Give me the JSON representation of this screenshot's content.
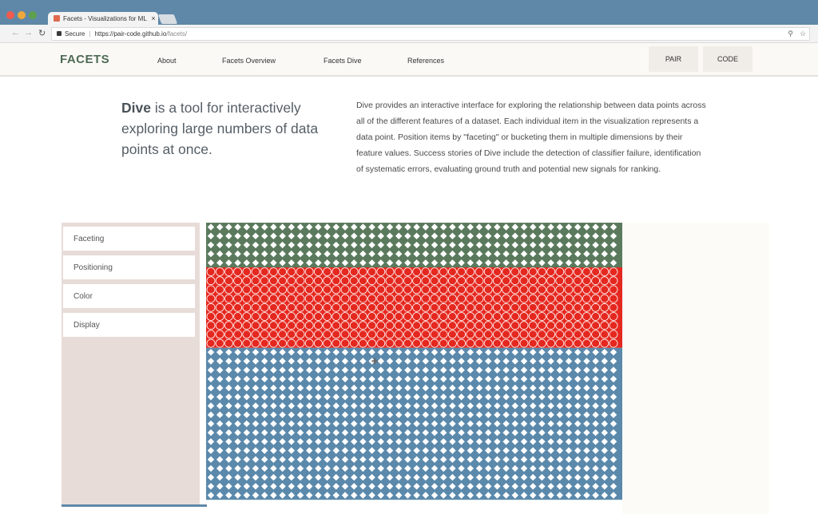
{
  "browser": {
    "tab_title": "Facets - Visualizations for ML",
    "tab_close": "×",
    "address": {
      "secure_label": "Secure",
      "separator": "|",
      "host": "https://pair-code.github.io",
      "path": "/facets/"
    },
    "window_controls": {
      "close_color": "#f25a50",
      "minimize_color": "#f0a83a",
      "maximize_color": "#5fa04e"
    }
  },
  "site": {
    "logo": "FACETS",
    "nav": [
      {
        "label": "About"
      },
      {
        "label": "Facets Overview"
      },
      {
        "label": "Facets Dive"
      },
      {
        "label": "References"
      }
    ],
    "buttons": [
      {
        "label": "PAIR"
      },
      {
        "label": "CODE"
      }
    ]
  },
  "intro": {
    "lead_bold": "Dive",
    "lead_rest": " is a tool for interactively exploring large numbers of data points at once.",
    "description": "Dive provides an interactive interface for exploring the relationship between data points across all of the different features of a dataset. Each individual item in the visualization represents a data point. Position items by \"faceting\" or bucketing them in multiple dimensions by their feature values. Success stories of Dive include the detection of classifier failure, identification of systematic errors, evaluating ground truth and potential new signals for ranking."
  },
  "dive": {
    "controls": [
      {
        "label": "Faceting"
      },
      {
        "label": "Positioning"
      },
      {
        "label": "Color"
      },
      {
        "label": "Display"
      }
    ],
    "bands": [
      {
        "color": "#5b7a5d",
        "shape": "diamond"
      },
      {
        "color": "#e5281f",
        "shape": "circle"
      },
      {
        "color": "#5b89ab",
        "shape": "diamond"
      }
    ]
  }
}
